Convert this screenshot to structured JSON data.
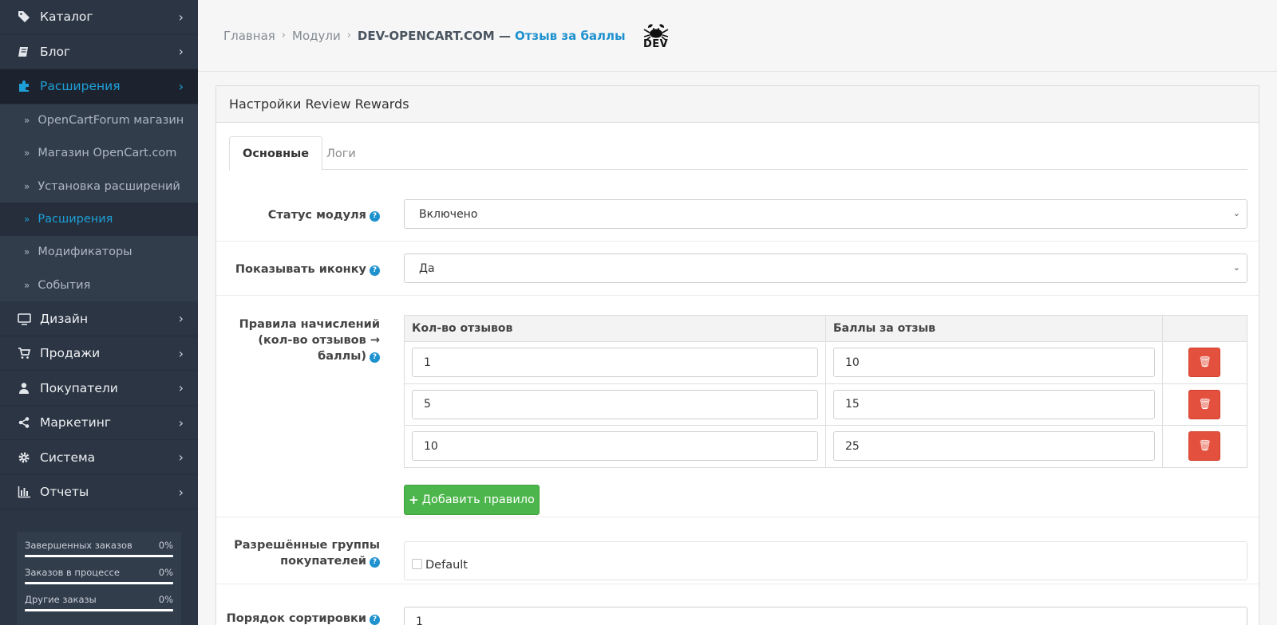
{
  "sidebar": {
    "items": [
      {
        "label": "Каталог",
        "icon": "tags-icon",
        "glyph": "🏷"
      },
      {
        "label": "Блог",
        "icon": "book-icon",
        "glyph": "▤"
      },
      {
        "label": "Расширения",
        "icon": "puzzle-icon",
        "glyph": "✚"
      }
    ],
    "sub_items": [
      "OpenCartForum магазин",
      "Магазин OpenCart.com",
      "Установка расширений",
      "Расширения",
      "Модификаторы",
      "События"
    ],
    "items_after": [
      {
        "label": "Дизайн",
        "icon": "monitor-icon",
        "glyph": "▭"
      },
      {
        "label": "Продажи",
        "icon": "cart-icon",
        "glyph": "⛟"
      },
      {
        "label": "Покупатели",
        "icon": "user-icon",
        "glyph": "👤"
      },
      {
        "label": "Маркетинг",
        "icon": "share-icon",
        "glyph": "⋖"
      },
      {
        "label": "Система",
        "icon": "gear-icon",
        "glyph": "⚙"
      },
      {
        "label": "Отчеты",
        "icon": "bar-chart-icon",
        "glyph": "▥"
      }
    ],
    "stats": [
      {
        "label": "Завершенных заказов",
        "value": "0%"
      },
      {
        "label": "Заказов в процессе",
        "value": "0%"
      },
      {
        "label": "Другие заказы",
        "value": "0%"
      }
    ]
  },
  "breadcrumb": {
    "home": "Главная",
    "modules": "Модули",
    "dev": "DEV-OPENCART.COM —",
    "title": "Отзыв за баллы",
    "logo_text": "DEV"
  },
  "panel": {
    "heading": "Настройки Review Rewards",
    "tabs": [
      "Основные",
      "Логи"
    ]
  },
  "form": {
    "status_label": "Статус модуля",
    "status_value": "Включено",
    "show_icon_label": "Показывать иконку",
    "show_icon_value": "Да",
    "rules_label_1": "Правила начислений",
    "rules_label_2": "(кол-во отзывов →",
    "rules_label_3": "баллы)",
    "rules_headers": [
      "Кол-во отзывов",
      "Баллы за отзыв"
    ],
    "rules": [
      {
        "reviews": "1",
        "points": "10"
      },
      {
        "reviews": "5",
        "points": "15"
      },
      {
        "reviews": "10",
        "points": "25"
      }
    ],
    "add_rule": "Добавить правило",
    "groups_label_1": "Разрешённые группы",
    "groups_label_2": "покупателей",
    "group_default": "Default",
    "sort_label": "Порядок сортировки",
    "sort_value": "1"
  },
  "colors": {
    "sidebar_bg": "#2b3543",
    "accent": "#1e91cf",
    "add_button": "#4cb64c",
    "delete_button": "#e3503e"
  }
}
